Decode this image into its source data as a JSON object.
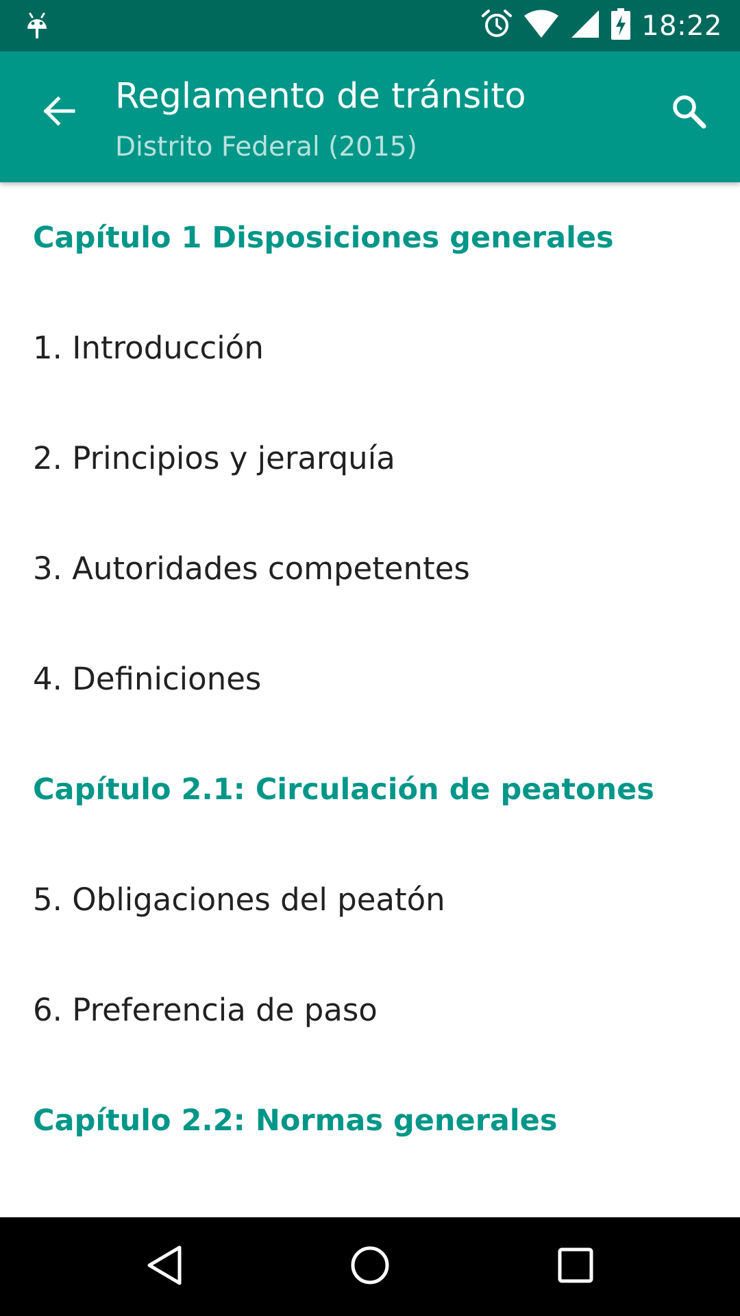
{
  "status_bar": {
    "time": "18:22",
    "icons": [
      "android-debug-icon",
      "alarm-icon",
      "wifi-icon",
      "signal-icon",
      "battery-charging-icon"
    ]
  },
  "toolbar": {
    "title": "Reglamento de tránsito",
    "subtitle": "Distrito Federal (2015)",
    "back_icon": "arrow-back-icon",
    "search_icon": "search-icon"
  },
  "list": {
    "rows": [
      {
        "type": "header",
        "text": "Capítulo 1 Disposiciones generales"
      },
      {
        "type": "item",
        "text": "1. Introducción"
      },
      {
        "type": "item",
        "text": "2. Principios y jerarquía"
      },
      {
        "type": "item",
        "text": "3. Autoridades competentes"
      },
      {
        "type": "item",
        "text": "4. Definiciones"
      },
      {
        "type": "header",
        "text": "Capítulo 2.1: Circulación de peatones"
      },
      {
        "type": "item",
        "text": "5. Obligaciones del peatón"
      },
      {
        "type": "item",
        "text": "6. Preferencia de paso"
      },
      {
        "type": "header",
        "text": "Capítulo 2.2: Normas generales"
      }
    ]
  },
  "nav_bar": {
    "icons": [
      "back-triangle-icon",
      "home-circle-icon",
      "recents-square-icon"
    ]
  },
  "colors": {
    "status_bar": "#00695c",
    "toolbar": "#009688",
    "accent": "#009688",
    "text_primary": "#212121",
    "nav_bar": "#000000"
  }
}
